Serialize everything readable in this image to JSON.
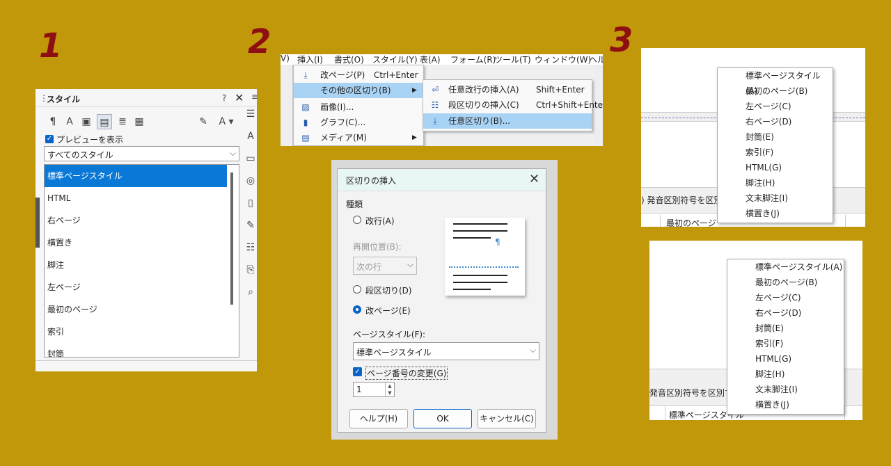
{
  "steps": {
    "one": "1",
    "two": "2",
    "three": "3"
  },
  "styles_panel": {
    "title": "スタイル",
    "help": "?",
    "close": "✕",
    "menu": "≡",
    "preview_label": "プレビューを表示",
    "filter_value": "すべてのスタイル",
    "items": [
      "標準ページスタイル",
      "HTML",
      "右ページ",
      "横置き",
      "脚注",
      "左ページ",
      "最初のページ",
      "索引",
      "封筒"
    ]
  },
  "insert_menu": {
    "menubar": [
      "V)",
      "挿入(I)",
      "書式(O)",
      "スタイル(Y)",
      "表(A)",
      "フォーム(R)",
      "ツール(T)",
      "ウィンドウ(W)",
      "ヘル"
    ],
    "items": [
      {
        "label": "改ページ(P)",
        "shortcut": "Ctrl+Enter",
        "icon": "page-break-icon"
      },
      {
        "label": "その他の区切り(B)",
        "shortcut": "",
        "icon": "",
        "arrow": "▶"
      },
      {
        "label": "画像(I)...",
        "shortcut": "",
        "icon": "image-icon"
      },
      {
        "label": "グラフ(C)...",
        "shortcut": "",
        "icon": "chart-icon"
      },
      {
        "label": "メディア(M)",
        "shortcut": "",
        "icon": "media-icon",
        "arrow": "▶"
      }
    ],
    "submenu": [
      {
        "label": "任意改行の挿入(A)",
        "shortcut": "Shift+Enter"
      },
      {
        "label": "段区切りの挿入(C)",
        "shortcut": "Ctrl+Shift+Enter"
      },
      {
        "label": "任意区切り(B)...",
        "shortcut": ""
      }
    ]
  },
  "break_dialog": {
    "title": "区切りの挿入",
    "close": "✕",
    "type_label": "種類",
    "line_break": "改行(A)",
    "restart_label": "再開位置(B):",
    "restart_value": "次の行",
    "column_break": "段区切り(D)",
    "page_break": "改ページ(E)",
    "page_style_label": "ページスタイル(F):",
    "page_style_value": "標準ページスタイル",
    "change_page_number": "ページ番号の変更(G)",
    "page_number": "1",
    "pilcrow": "¶",
    "help_button": "ヘルプ(H)",
    "ok_button": "OK",
    "cancel_button": "キャンセル(C)"
  },
  "page_style_list": [
    "標準ページスタイル(A)",
    "最初のページ(B)",
    "左ページ(C)",
    "右ページ(D)",
    "封筒(E)",
    "索引(F)",
    "HTML(G)",
    "脚注(H)",
    "文末脚注(I)",
    "横置き(J)"
  ],
  "panel4": {
    "bg_text": ") 発音区別符号を区別",
    "footer_text": "最初のページ"
  },
  "panel5": {
    "bg_text": "発音区別符号を区別する",
    "footer_text": "標準ページスタイル"
  }
}
